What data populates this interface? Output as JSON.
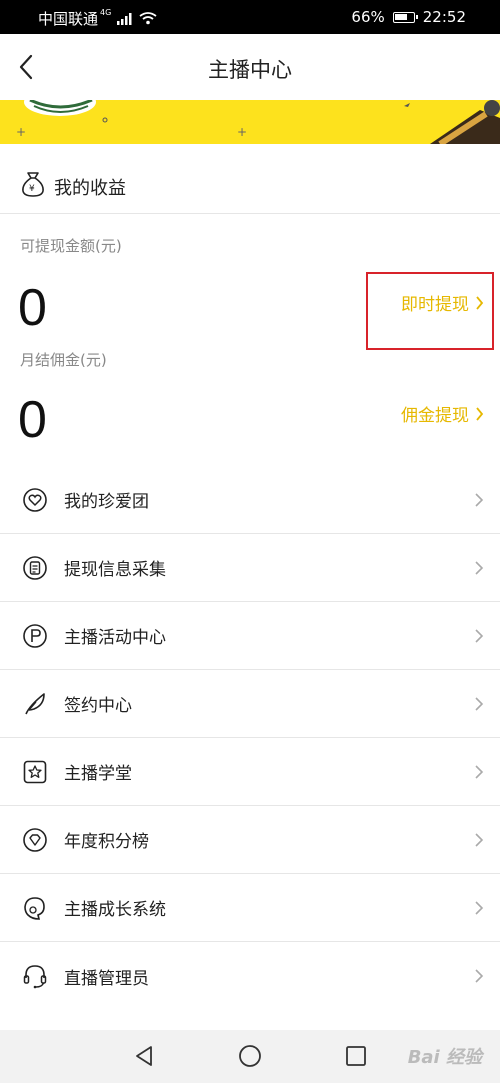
{
  "status_bar": {
    "carrier": "中国联通",
    "network": "4G",
    "battery": "66%",
    "time": "22:52"
  },
  "nav": {
    "title": "主播中心"
  },
  "earnings": {
    "section_title": "我的收益",
    "withdrawable_label": "可提现金额(元)",
    "withdrawable_value": "0",
    "instant_withdraw": "即时提现",
    "monthly_label": "月结佣金(元)",
    "monthly_value": "0",
    "commission_withdraw": "佣金提现"
  },
  "menu": {
    "items": [
      {
        "label": "我的珍爱团",
        "icon": "heart-badge-icon"
      },
      {
        "label": "提现信息采集",
        "icon": "document-icon"
      },
      {
        "label": "主播活动中心",
        "icon": "flag-circle-icon"
      },
      {
        "label": "签约中心",
        "icon": "feather-icon"
      },
      {
        "label": "主播学堂",
        "icon": "star-square-icon"
      },
      {
        "label": "年度积分榜",
        "icon": "diamond-icon"
      },
      {
        "label": "主播成长系统",
        "icon": "growth-icon"
      },
      {
        "label": "直播管理员",
        "icon": "headset-icon"
      }
    ]
  },
  "watermark": "Bai 经验",
  "colors": {
    "accent": "#e6b800",
    "banner": "#fde21d",
    "highlight": "#d8232a"
  }
}
